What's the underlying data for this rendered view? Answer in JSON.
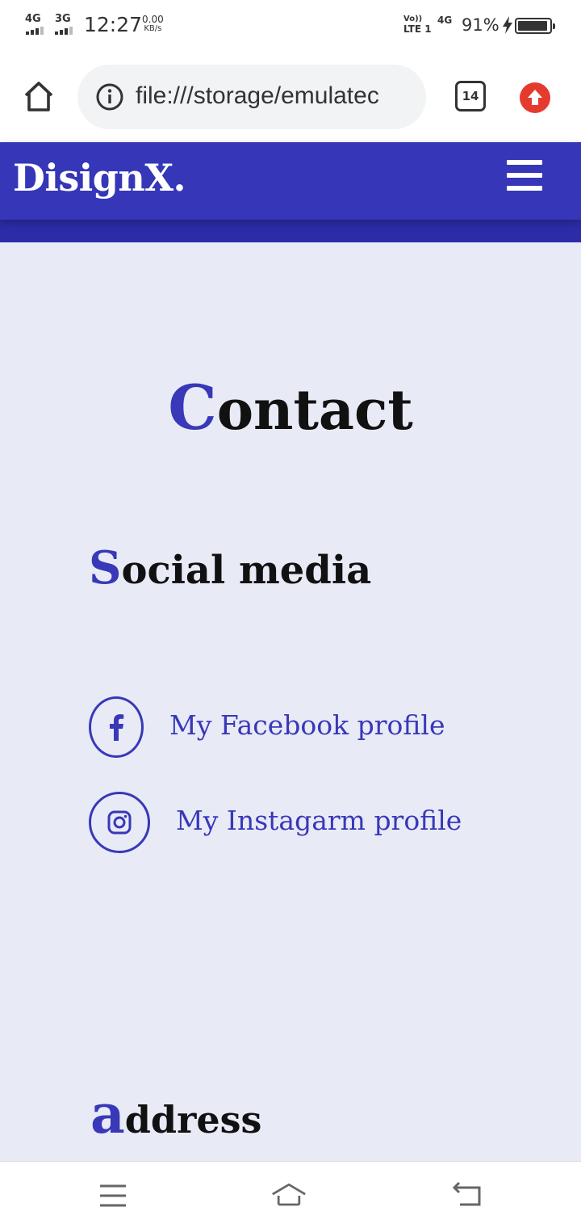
{
  "status_bar": {
    "network_1": "4G",
    "network_2": "3G",
    "time": "12:27",
    "speed_value": "0.00",
    "speed_unit": "KB/s",
    "volte_line1": "Vo))",
    "volte_line2": "LTE 1",
    "network_3": "4G",
    "battery_percent": "91%",
    "icons": [
      "signal-icon",
      "signal-icon",
      "charging-icon",
      "battery-icon"
    ]
  },
  "browser": {
    "url": "file:///storage/emulatec",
    "tab_count": "14",
    "icons": [
      "home-icon",
      "info-icon",
      "tabs-icon",
      "update-icon"
    ],
    "update_color": "#e53b2f"
  },
  "site": {
    "logo": "DisignX.",
    "menu_icon": "hamburger-icon",
    "header_color": "#3636b8"
  },
  "contact": {
    "title_initial": "C",
    "title_rest": "ontact",
    "social_initial": "S",
    "social_rest": "ocial media",
    "links": [
      {
        "label": "My Facebook profile",
        "icon": "facebook-icon"
      },
      {
        "label": "My Instagarm profile",
        "icon": "instagram-icon"
      }
    ],
    "address_initial": "a",
    "address_rest": "ddress",
    "accent_color": "#3838b8",
    "background_color": "#e8eaf6"
  },
  "nav_bar": {
    "icons": [
      "menu-icon",
      "home-icon",
      "back-icon"
    ]
  }
}
